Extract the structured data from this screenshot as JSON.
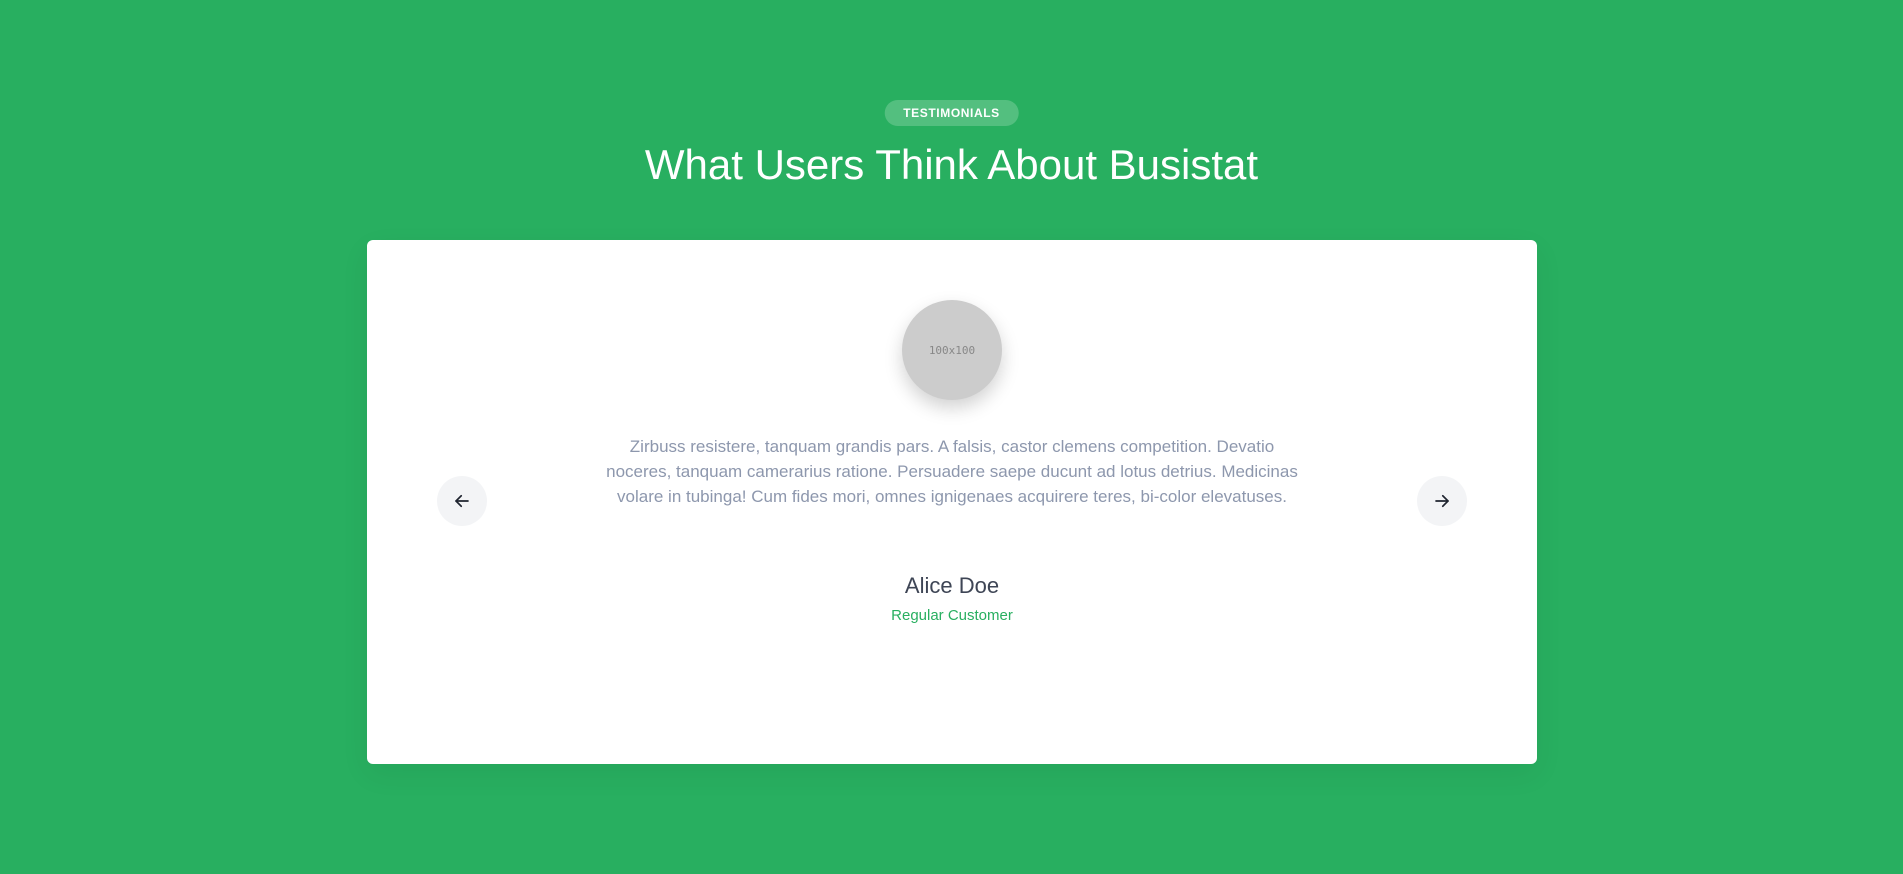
{
  "section": {
    "badge": "TESTIMONIALS",
    "heading": "What Users Think About Busistat"
  },
  "testimonial": {
    "avatar_placeholder": "100x100",
    "quote": "Zirbuss resistere, tanquam grandis pars. A falsis, castor clemens competition. Devatio noceres, tanquam camerarius ratione. Persuadere saepe ducunt ad lotus detrius. Medicinas volare in tubinga! Cum fides mori, omnes ignigenaes acquirere teres, bi-color elevatuses.",
    "name": "Alice Doe",
    "role": "Regular Customer"
  },
  "navigation": {
    "prev_icon": "arrow-left-icon",
    "next_icon": "arrow-right-icon"
  },
  "colors": {
    "background": "#28af60",
    "accent": "#28af60",
    "card": "#ffffff",
    "quote_text": "#8d97ad",
    "name_text": "#3e4555"
  }
}
